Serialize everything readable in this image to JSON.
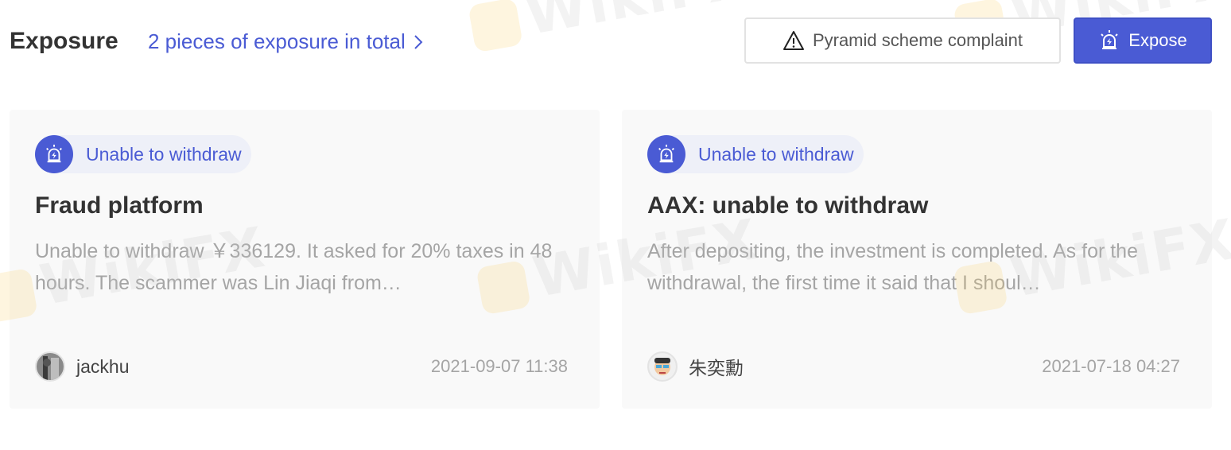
{
  "header": {
    "title": "Exposure",
    "total_link": "2 pieces of exposure in total",
    "pyramid_button": "Pyramid scheme complaint",
    "expose_button": "Expose"
  },
  "watermark": "WikiFX",
  "colors": {
    "accent": "#4a5bd4",
    "card_bg": "#f9f9f9",
    "tag_bg": "#eef0f8",
    "muted_text": "#a5a5a5"
  },
  "cards": [
    {
      "tag": "Unable to withdraw",
      "tag_icon": "alarm-lightning-icon",
      "title": "Fraud platform",
      "description": "Unable to withdraw ￥336129. It asked for 20% taxes in 48 hours. The scammer was Lin Jiaqi from…",
      "author": "jackhu",
      "date": "2021-09-07 11:38"
    },
    {
      "tag": "Unable to withdraw",
      "tag_icon": "alarm-lightning-icon",
      "title": "AAX: unable to withdraw",
      "description": "After depositing, the investment is completed. As for the withdrawal, the first time it said that I shoul…",
      "author": "朱奕勳",
      "date": "2021-07-18 04:27"
    }
  ]
}
